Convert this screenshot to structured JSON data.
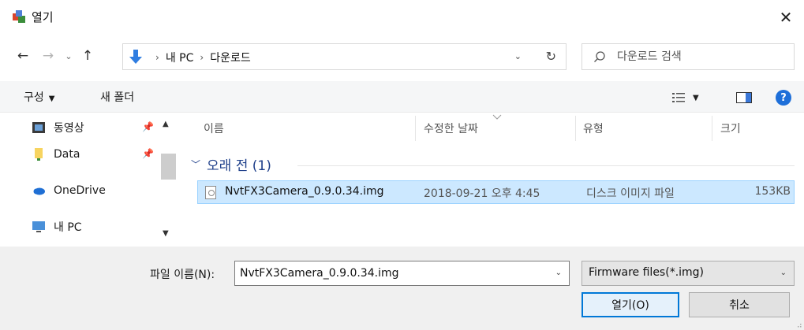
{
  "window": {
    "title": "열기"
  },
  "address": {
    "crumbs": [
      "내 PC",
      "다운로드"
    ]
  },
  "search": {
    "placeholder": "다운로드 검색"
  },
  "toolbar": {
    "organize_label": "구성",
    "new_folder_label": "새 폴더"
  },
  "navpane": {
    "items": [
      {
        "label": "동영상",
        "icon": "video-icon",
        "pinned": true
      },
      {
        "label": "Data",
        "icon": "folder-icon",
        "pinned": true
      },
      {
        "label": "OneDrive",
        "icon": "cloud-icon",
        "pinned": false
      },
      {
        "label": "내 PC",
        "icon": "computer-icon",
        "pinned": false
      }
    ]
  },
  "filelist": {
    "columns": [
      "이름",
      "수정한 날짜",
      "유형",
      "크기"
    ],
    "group_label": "오래 전 (1)",
    "rows": [
      {
        "name": "NvtFX3Camera_0.9.0.34.img",
        "date": "2018-09-21 오후 4:45",
        "type": "디스크 이미지 파일",
        "size": "153KB"
      }
    ]
  },
  "footer": {
    "filename_label": "파일 이름(N):",
    "filename_value": "NvtFX3Camera_0.9.0.34.img",
    "filter_value": "Firmware files(*.img)",
    "open_label": "열기(O)",
    "cancel_label": "취소"
  },
  "colors": {
    "accent": "#0078d7",
    "selection": "#cce8ff",
    "help": "#1e6fd9"
  }
}
